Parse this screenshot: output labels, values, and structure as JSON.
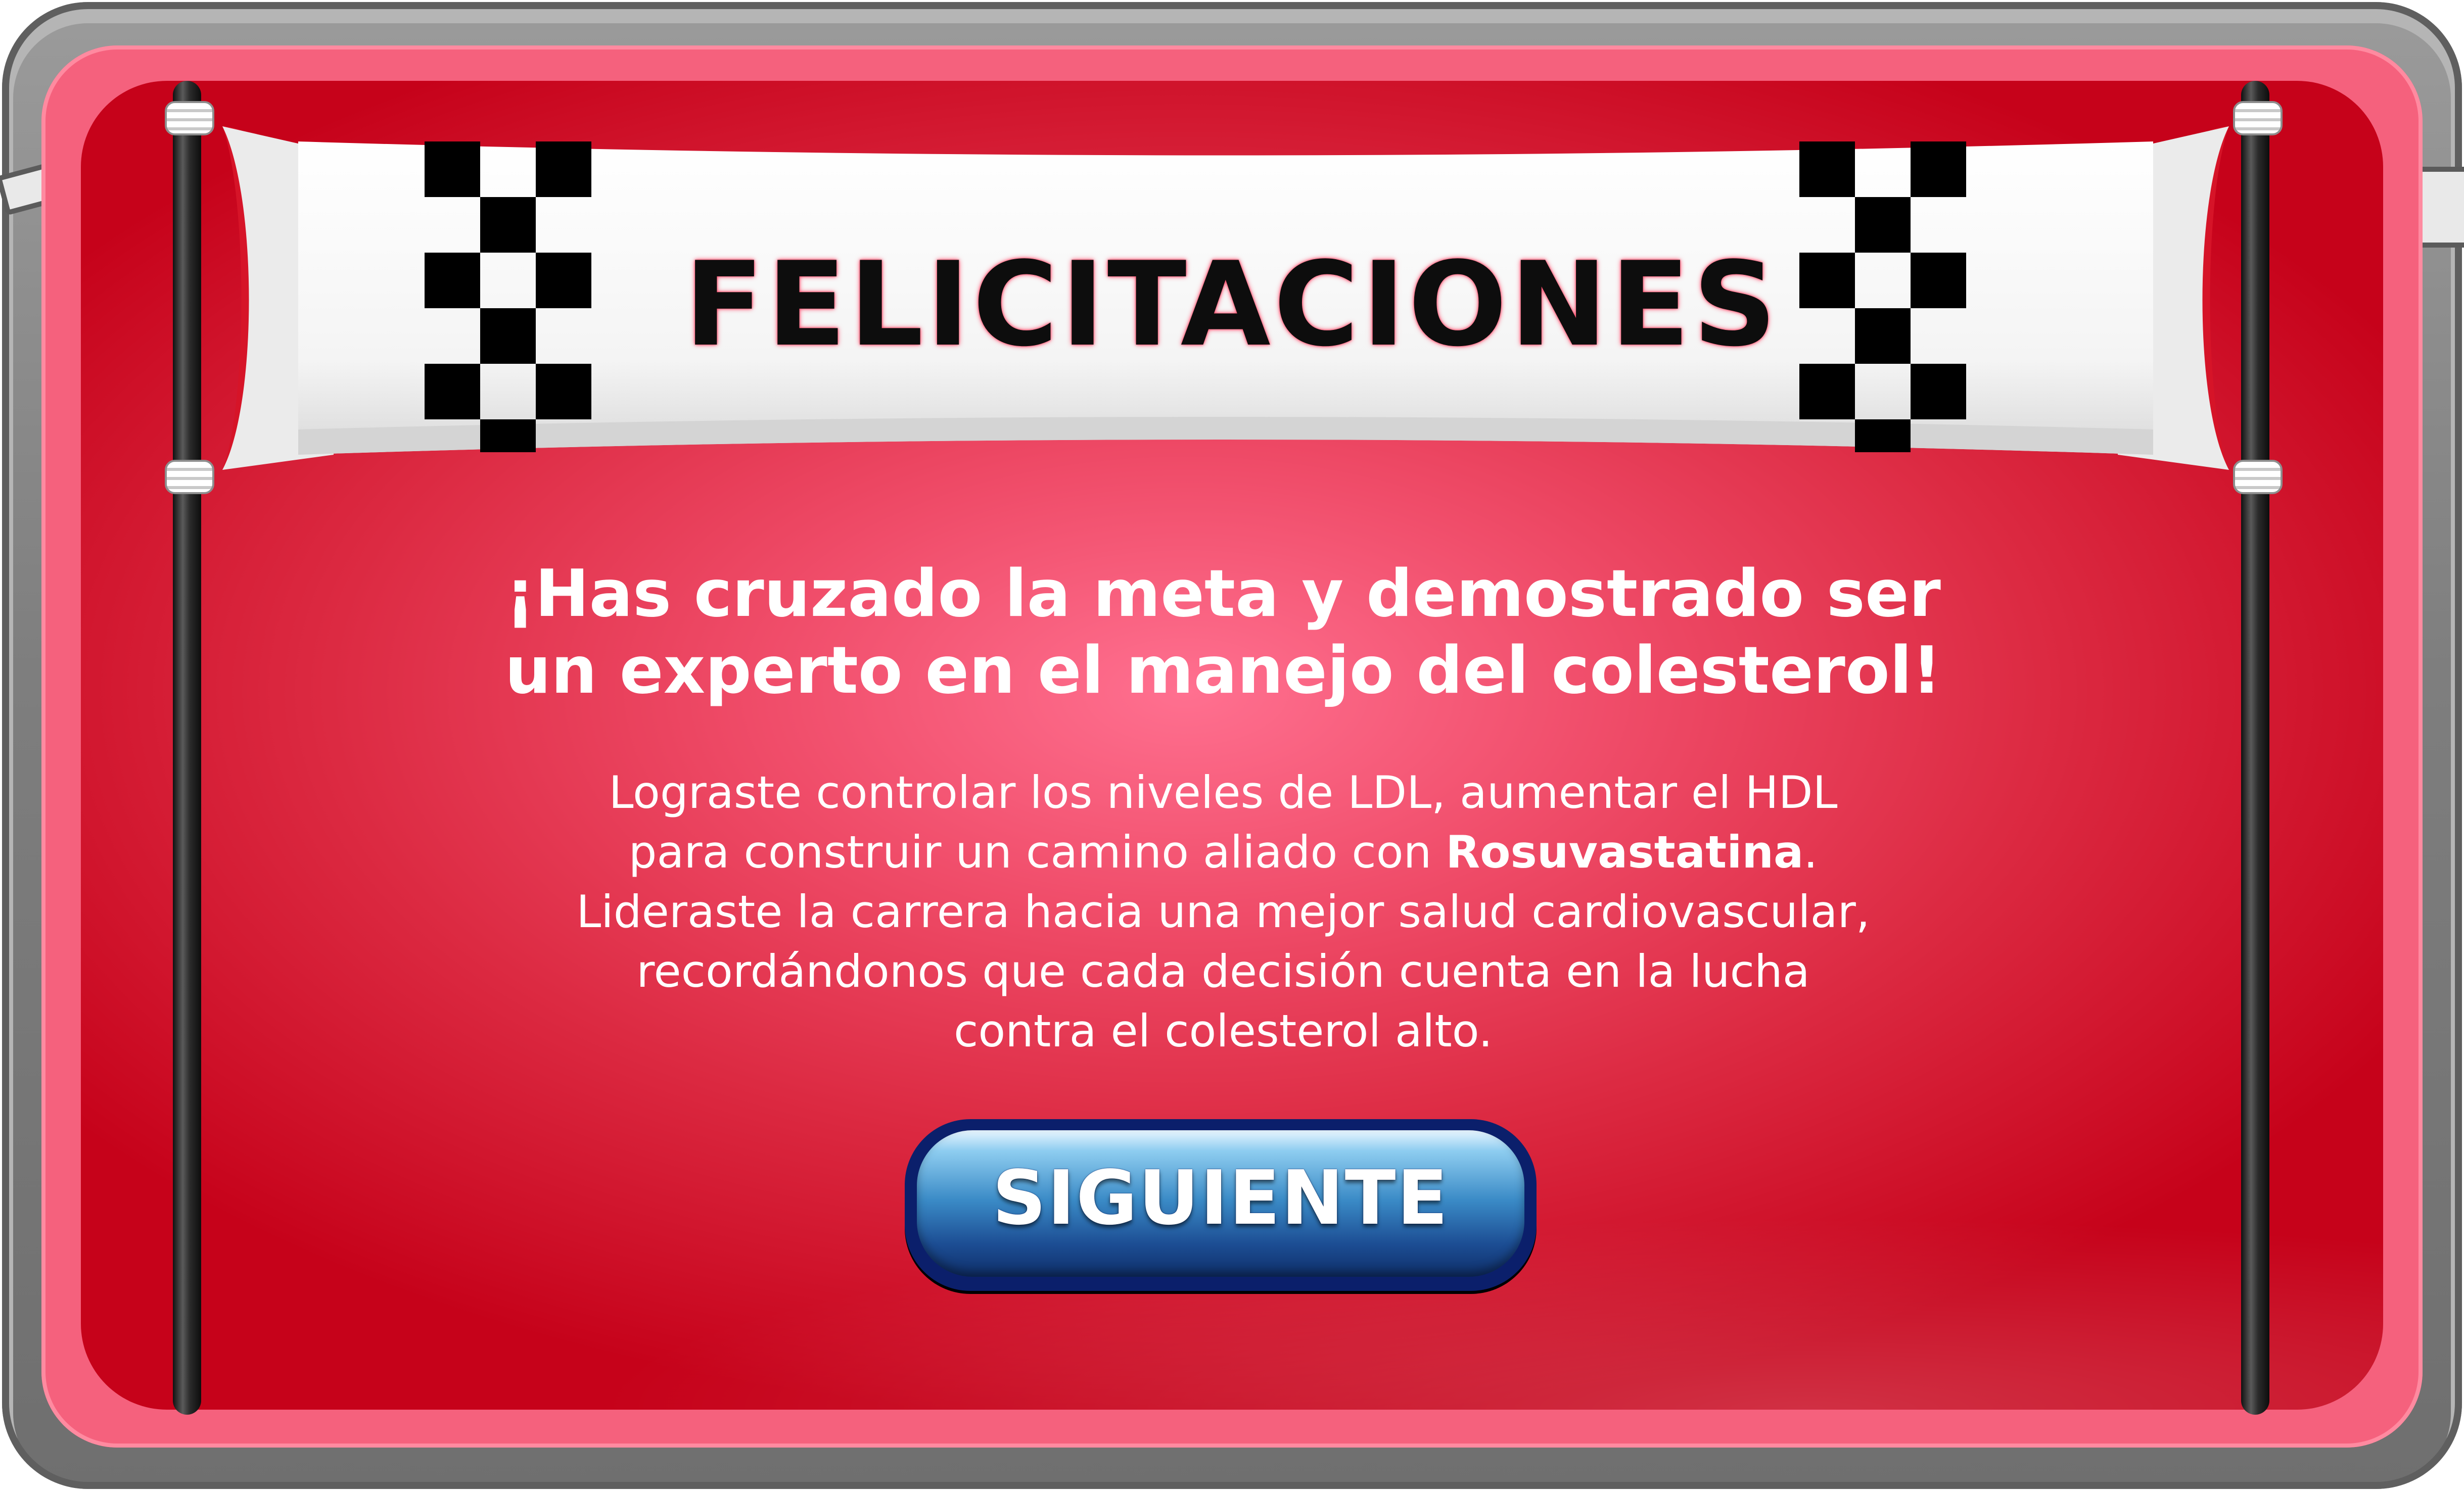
{
  "banner": {
    "title": "FELICITACIONES"
  },
  "headline": {
    "line1": "¡Has cruzado la meta y demostrado ser",
    "line2": "un experto en el manejo del colesterol!"
  },
  "body": {
    "line1": "Lograste controlar los niveles de LDL, aumentar el HDL",
    "line2_pre": "para construir un camino aliado con ",
    "line2_bold": "Rosuvastatina",
    "line2_post": ".",
    "line3": "Lideraste la carrera hacia una mejor salud cardiovascular,",
    "line4": "recordándonos que cada decisión cuenta en la lucha",
    "line5": "contra el colesterol alto."
  },
  "next_button": {
    "label": "SIGUIENTE"
  },
  "colors": {
    "panel_red": "#c6021a",
    "panel_glow": "#ff7090",
    "frame_pink": "#f5617d",
    "frame_gray": "#7e7e7e",
    "button_blue": "#1c4d93",
    "checker_black": "#000000"
  }
}
